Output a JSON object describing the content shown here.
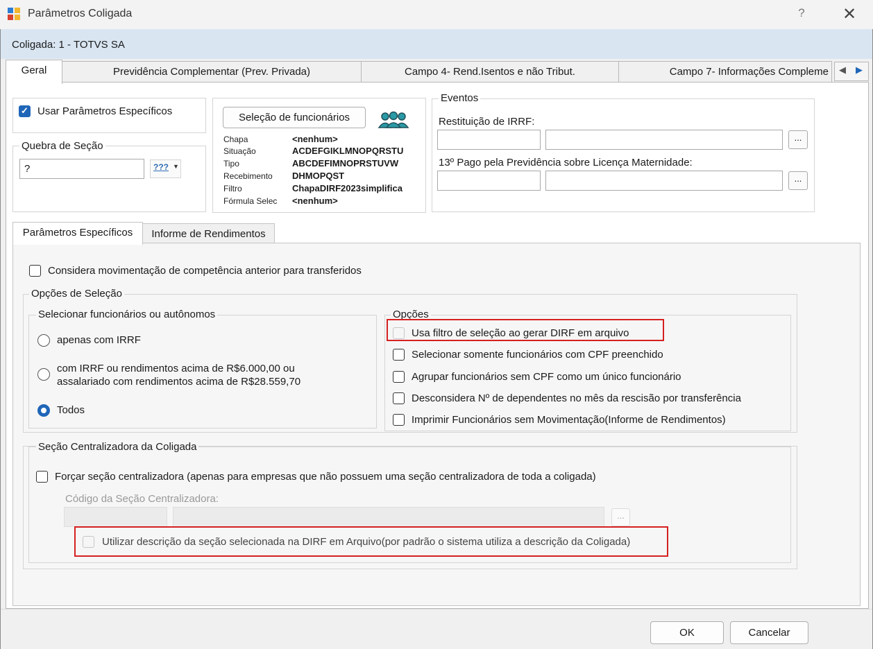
{
  "window": {
    "title": "Parâmetros Coligada",
    "help_label": "?",
    "close_label": "✕"
  },
  "coligada_bar": {
    "text": "Coligada: 1 - TOTVS SA"
  },
  "tabs": [
    {
      "label": "Geral"
    },
    {
      "label": "Previdência Complementar (Prev. Privada)"
    },
    {
      "label": "Campo 4- Rend.Isentos e não Tribut."
    },
    {
      "label": "Campo 7- Informações Compleme"
    }
  ],
  "tab_nav": {
    "prev": "◀",
    "next": "▶"
  },
  "usar_parametros": {
    "label": "Usar Parâmetros Específicos",
    "checked": true
  },
  "quebra_secao": {
    "legend": "Quebra de Seção",
    "value": "?",
    "picker_label": "???"
  },
  "selecao": {
    "button_label": "Seleção de funcionários",
    "rows": [
      {
        "label": "Chapa",
        "value": "<nenhum>"
      },
      {
        "label": "Situação",
        "value": "ACDEFGIKLMNOPQRSTU"
      },
      {
        "label": "Tipo",
        "value": "ABCDEFIMNOPRSTUVW"
      },
      {
        "label": "Recebimento",
        "value": "DHMOPQST"
      },
      {
        "label": "Filtro",
        "value": "ChapaDIRF2023simplifica"
      },
      {
        "label": "Fórmula Selec",
        "value": "<nenhum>"
      }
    ]
  },
  "eventos": {
    "legend": "Eventos",
    "restituicao_label": "Restituição de IRRF:",
    "decimo_label": "13º Pago pela Previdência sobre Licença Maternidade:",
    "lookup_label": "..."
  },
  "subtabs": [
    {
      "label": "Parâmetros Específicos"
    },
    {
      "label": "Informe de Rendimentos"
    }
  ],
  "considera_mov": {
    "label": "Considera movimentação de competência anterior para transferidos",
    "checked": false
  },
  "opcoes_selecao": {
    "legend": "Opções de Seleção",
    "selecionar_legend": "Selecionar funcionários ou autônomos",
    "radios": [
      {
        "label": "apenas com IRRF",
        "checked": false
      },
      {
        "label_line1": "com IRRF ou rendimentos acima de R$6.000,00 ou",
        "label_line2": "assalariado com rendimentos acima de R$28.559,70",
        "checked": false
      },
      {
        "label": "Todos",
        "checked": true
      }
    ],
    "opcoes_legend": "Opções",
    "checkboxes": [
      {
        "label": "Usa filtro de seleção ao gerar DIRF em arquivo",
        "checked": false,
        "disabled": true
      },
      {
        "label": "Selecionar somente funcionários com CPF preenchido",
        "checked": false,
        "disabled": false
      },
      {
        "label": "Agrupar funcionários sem CPF como um único funcionário",
        "checked": false,
        "disabled": false
      },
      {
        "label": "Desconsidera Nº de dependentes no mês da rescisão por transferência",
        "checked": false,
        "disabled": false
      },
      {
        "label": "Imprimir Funcionários sem Movimentação(Informe de Rendimentos)",
        "checked": false,
        "disabled": false
      }
    ]
  },
  "secao_centralizadora": {
    "legend": "Seção Centralizadora da Coligada",
    "forcar_label": "Forçar seção centralizadora  (apenas para empresas que não possuem uma seção centralizadora de toda a coligada)",
    "codigo_label": "Código da Seção Centralizadora:",
    "utilizar_label": "Utilizar descrição da seção selecionada na DIRF em Arquivo(por padrão o sistema utiliza a descrição da Coligada)"
  },
  "footer": {
    "ok_label": "OK",
    "cancel_label": "Cancelar"
  },
  "colors": {
    "accent": "#1f66b8",
    "highlight": "#d62020",
    "coligada_bar": "#d9e6f2"
  }
}
